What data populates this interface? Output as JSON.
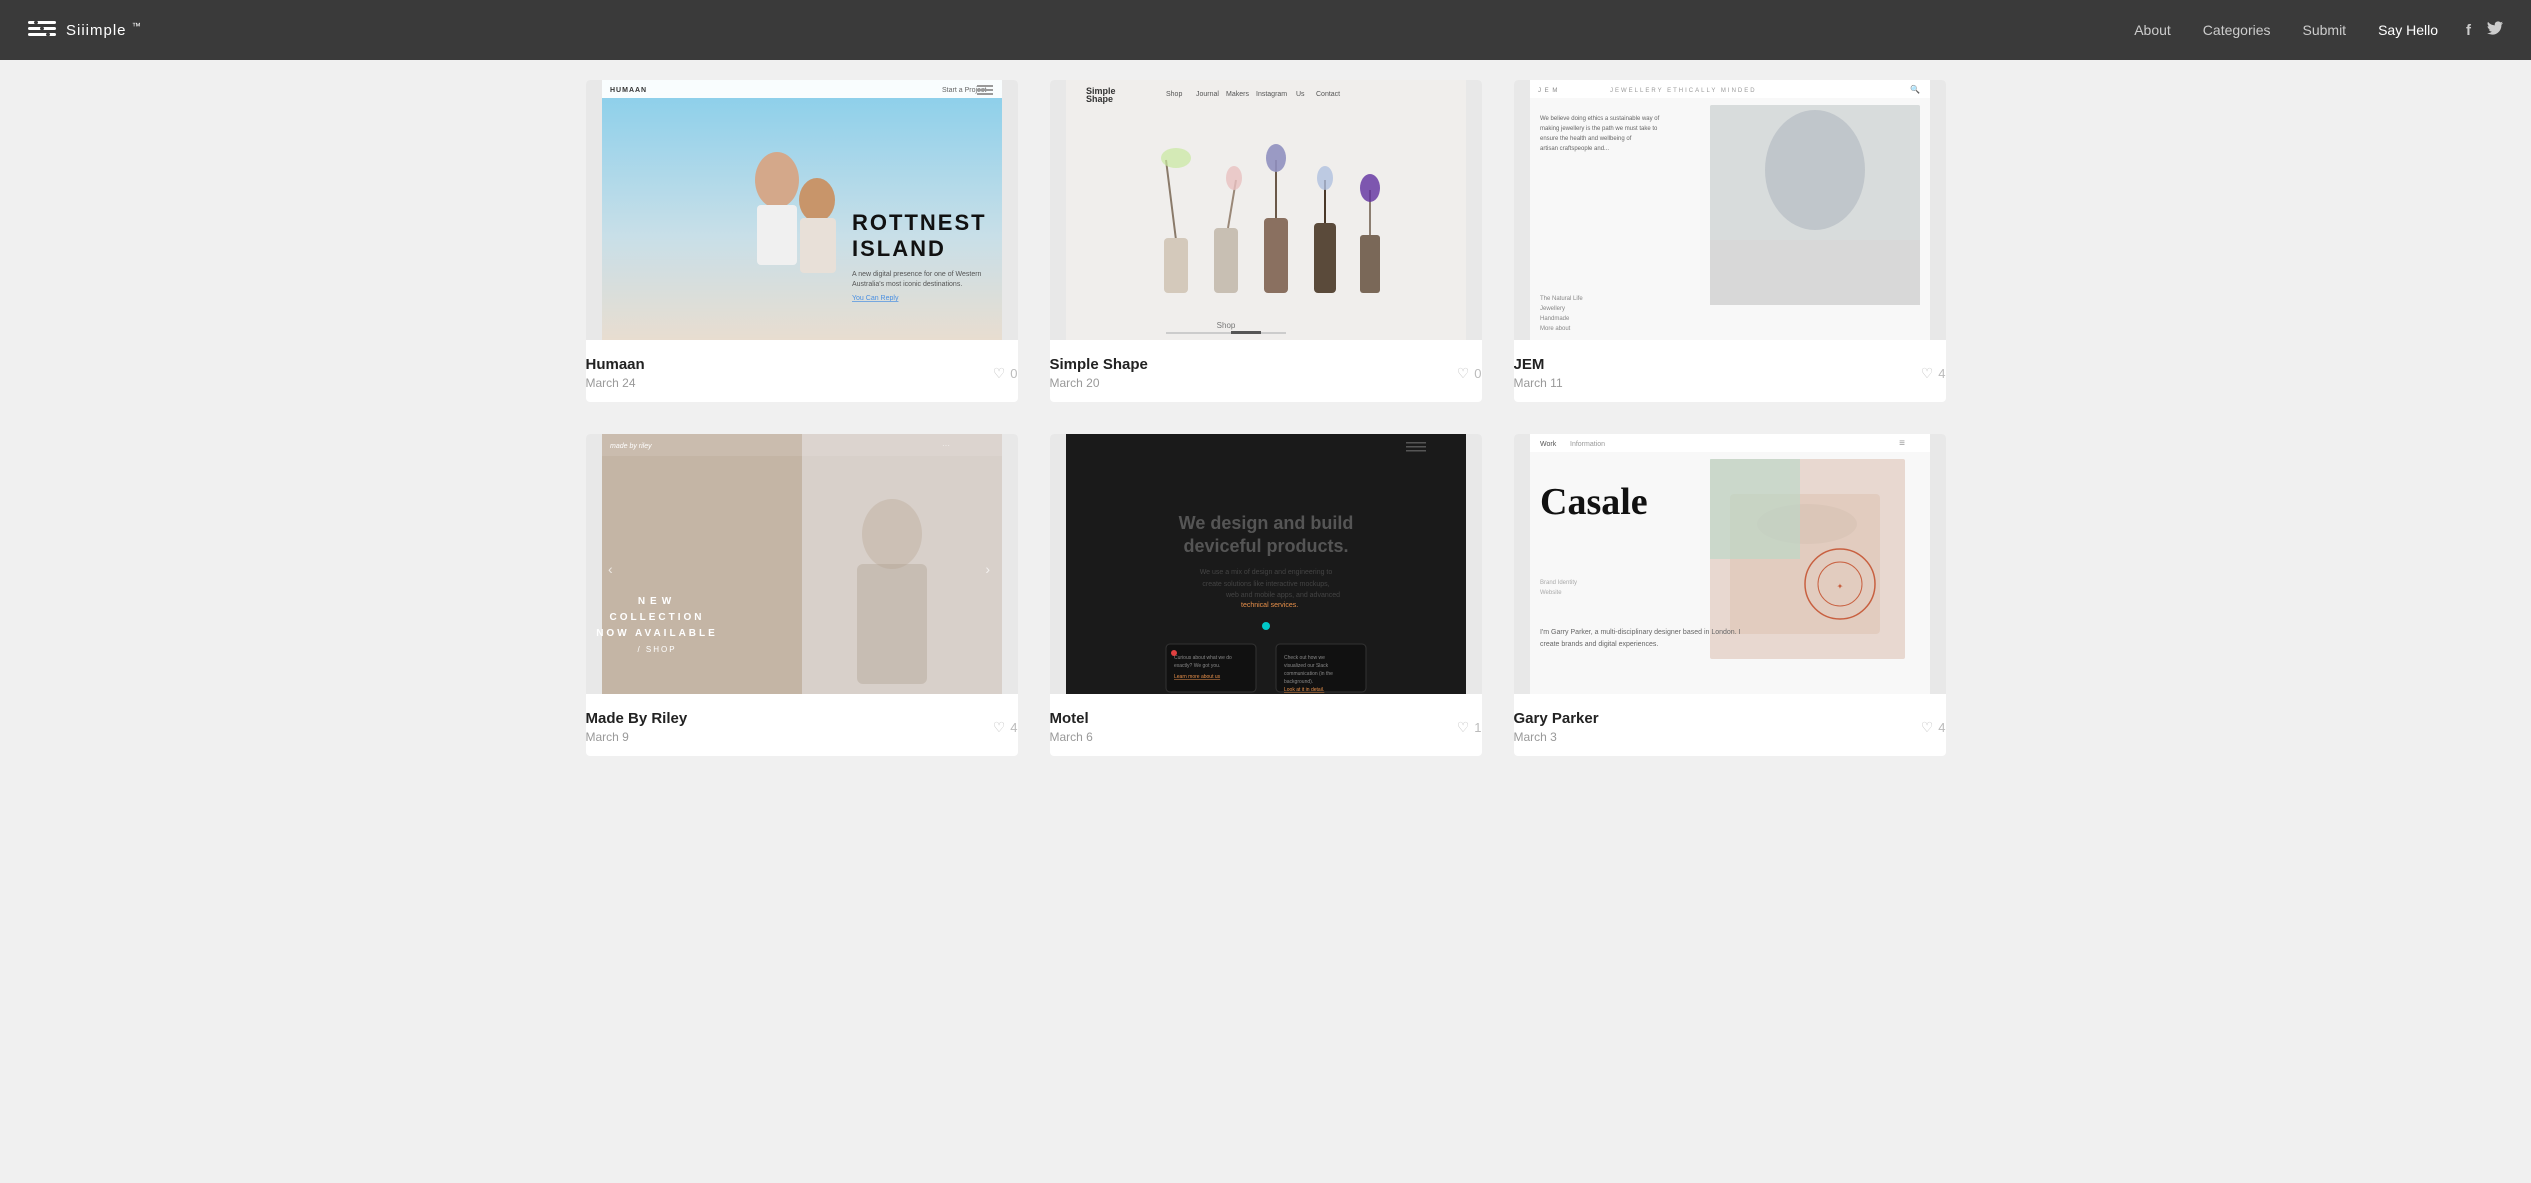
{
  "nav": {
    "brand": "Siiimple",
    "brand_tm": "™",
    "links": [
      {
        "label": "About",
        "id": "about"
      },
      {
        "label": "Categories",
        "id": "categories"
      },
      {
        "label": "Submit",
        "id": "submit"
      },
      {
        "label": "Say Hello",
        "id": "say-hello"
      }
    ],
    "socials": [
      {
        "icon": "f",
        "id": "facebook"
      },
      {
        "icon": "🐦",
        "id": "twitter"
      }
    ]
  },
  "cards": [
    {
      "id": "humaan",
      "title": "Humaan",
      "date": "March 24",
      "likes": 0,
      "thumb_type": "humaan"
    },
    {
      "id": "simple-shape",
      "title": "Simple Shape",
      "date": "March 20",
      "likes": 0,
      "thumb_type": "simpleshape"
    },
    {
      "id": "jem",
      "title": "JEM",
      "date": "March 11",
      "likes": 4,
      "thumb_type": "jem"
    },
    {
      "id": "made-by-riley",
      "title": "Made By Riley",
      "date": "March 9",
      "likes": 4,
      "thumb_type": "madebyriley"
    },
    {
      "id": "motel",
      "title": "Motel",
      "date": "March 6",
      "likes": 1,
      "thumb_type": "motel"
    },
    {
      "id": "gary-parker",
      "title": "Gary Parker",
      "date": "March 3",
      "likes": 4,
      "thumb_type": "garyparker"
    }
  ],
  "icons": {
    "heart": "♡",
    "facebook": "f",
    "twitter": "𝕏"
  }
}
